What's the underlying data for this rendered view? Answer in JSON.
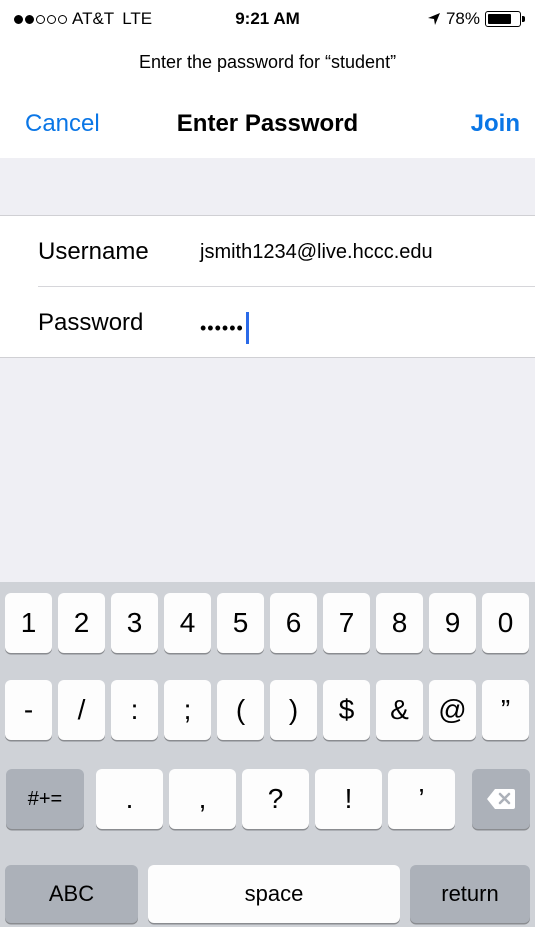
{
  "status": {
    "carrier": "AT&T",
    "network": "LTE",
    "time": "9:21 AM",
    "battery": "78%",
    "battery_level": 0.78
  },
  "prompt": "Enter the password for “student”",
  "nav": {
    "cancel": "Cancel",
    "title": "Enter Password",
    "join": "Join"
  },
  "form": {
    "username_label": "Username",
    "username_value": "jsmith1234@live.hccc.edu",
    "password_label": "Password",
    "password_value": "••••••"
  },
  "keyboard": {
    "row1": [
      "1",
      "2",
      "3",
      "4",
      "5",
      "6",
      "7",
      "8",
      "9",
      "0"
    ],
    "row2": [
      "-",
      "/",
      ":",
      ";",
      "(",
      ")",
      "$",
      "&",
      "@",
      "”"
    ],
    "row3": {
      "symbols": "#+=",
      "keys": [
        ".",
        ",",
        "?",
        "!",
        "’"
      ]
    },
    "row4": {
      "abc": "ABC",
      "space": "space",
      "return": "return"
    }
  },
  "colors": {
    "accent": "#0a76e6",
    "keyboard_bg": "#cfd2d7",
    "cursor": "#2a6ae8"
  }
}
